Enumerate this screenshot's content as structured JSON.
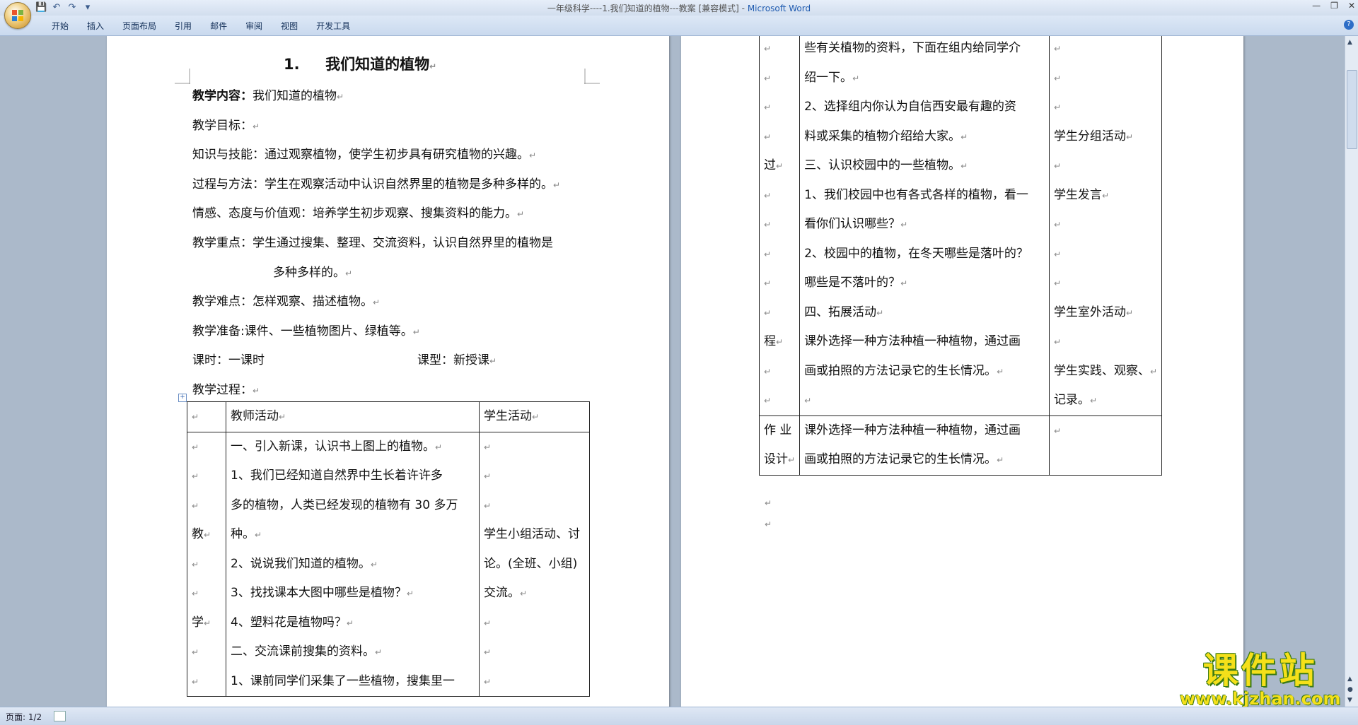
{
  "window": {
    "title": "一年级科学----1.我们知道的植物---教案 [兼容模式] - ",
    "app": "Microsoft Word"
  },
  "ribbon": {
    "tabs": [
      "开始",
      "插入",
      "页面布局",
      "引用",
      "邮件",
      "审阅",
      "视图",
      "开发工具"
    ]
  },
  "page1": {
    "title_num": "1.",
    "title": "我们知道的植物",
    "content_label": "教学内容：",
    "content_value": "我们知道的植物",
    "goal": "教学目标：",
    "knowledge": "知识与技能：通过观察植物，使学生初步具有研究植物的兴趣。",
    "process": "过程与方法：学生在观察活动中认识自然界里的植物是多种多样的。",
    "emotion": "情感、态度与价值观：培养学生初步观察、搜集资料的能力。",
    "key1": "教学重点：学生通过搜集、整理、交流资料，认识自然界里的植物是",
    "key2": "多种多样的。",
    "difficulty": "教学难点：怎样观察、描述植物。",
    "prep": "教学准备:课件、一些植物图片、绿植等。",
    "hours": "课时：一课时",
    "type": "课型：新授课",
    "proc_label": "教学过程：",
    "table": {
      "h_teacher": "教师活动",
      "h_student": "学生活动",
      "left_col": [
        "",
        "",
        "",
        "教",
        "",
        "",
        "学",
        "",
        ""
      ],
      "teacher_lines": [
        "一、引入新课，认识书上图上的植物。",
        "1、我们已经知道自然界中生长着许许多",
        "多的植物，人类已经发现的植物有 30 多万",
        "种。",
        "2、说说我们知道的植物。",
        "3、找找课本大图中哪些是植物？",
        "4、塑料花是植物吗？",
        "二、交流课前搜集的资料。",
        "1、课前同学们采集了一些植物，搜集里一"
      ],
      "student_lines": [
        "",
        "",
        "",
        "学生小组活动、讨",
        "论。(全班、小组)",
        "交流。",
        "",
        "",
        ""
      ]
    }
  },
  "page2": {
    "left_col": [
      "",
      "",
      "",
      "",
      "过",
      "",
      "",
      "",
      "",
      "",
      "程",
      "",
      ""
    ],
    "teacher_lines": [
      "些有关植物的资料，下面在组内给同学介",
      "绍一下。",
      "2、选择组内你认为自信西安最有趣的资",
      "料或采集的植物介绍给大家。",
      "三、认识校园中的一些植物。",
      "1、我们校园中也有各式各样的植物，看一",
      "看你们认识哪些？",
      "2、校园中的植物，在冬天哪些是落叶的？",
      "哪些是不落叶的？",
      "四、拓展活动",
      "课外选择一种方法种植一种植物，通过画",
      "画或拍照的方法记录它的生长情况。",
      ""
    ],
    "student_lines": [
      "",
      "",
      "",
      "学生分组活动",
      "",
      "学生发言",
      "",
      "",
      "",
      "学生室外活动",
      "",
      "学生实践、观察、",
      "记录。"
    ],
    "hw_label_1": "作 业",
    "hw_label_2": "设计",
    "hw_text_1": "课外选择一种方法种植一种植物，通过画",
    "hw_text_2": "画或拍照的方法记录它的生长情况。"
  },
  "status": {
    "page": "页面: 1/2"
  },
  "watermark": {
    "brand": "课件站",
    "url": "www.kjzhan.com"
  },
  "paragraph_mark": "↵"
}
